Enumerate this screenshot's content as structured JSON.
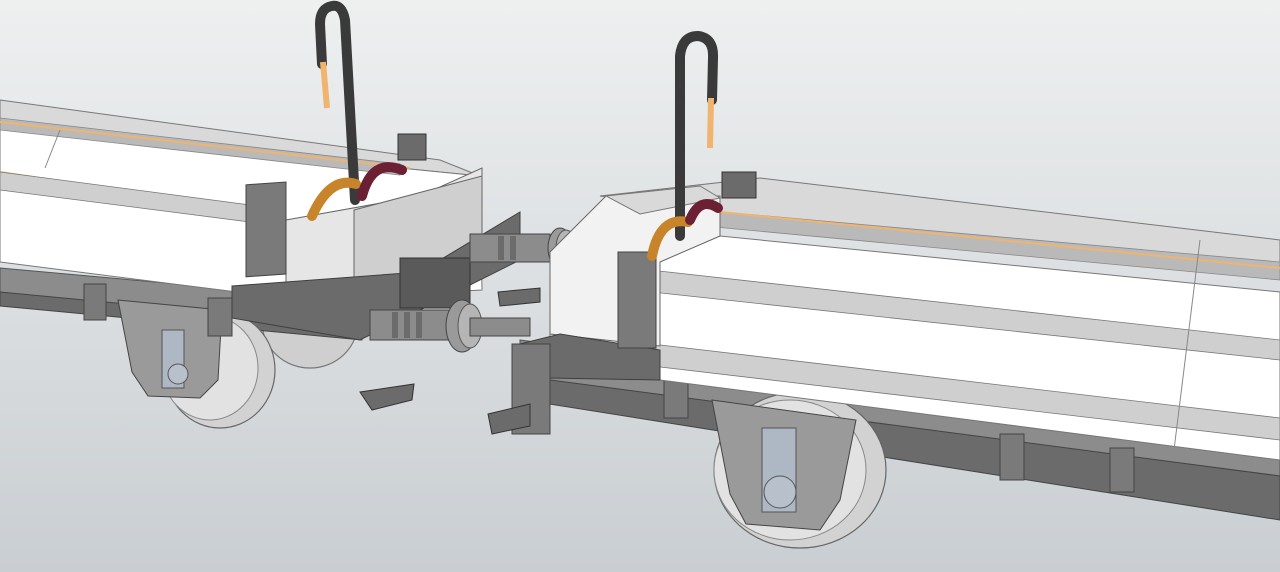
{
  "scene": {
    "background_top": "#eef0f0",
    "background_bottom": "#c9ced2",
    "body_white": "#ffffff",
    "body_light": "#d9d9d9",
    "frame_dark": "#6b6b6b",
    "frame_mid": "#8c8c8c",
    "frame_darker": "#4f4f4f",
    "wheel": "#d2d2d2",
    "axle_blue": "#aeb7c4",
    "pipe_black": "#3a3a3a",
    "pipe_copper": "#c8842a",
    "pipe_maroon": "#6b2033",
    "tip_orange": "#f0b46e",
    "icons": [
      "wagon-left",
      "wagon-right",
      "coupling-buffers",
      "brake-pipe-hooks",
      "wheelsets"
    ]
  }
}
